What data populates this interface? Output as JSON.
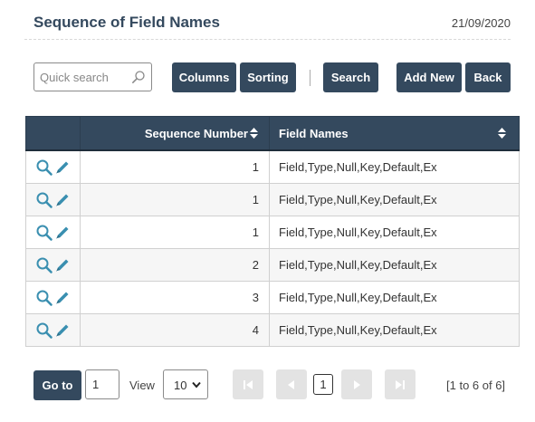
{
  "header": {
    "title": "Sequence of Field Names",
    "date": "21/09/2020"
  },
  "toolbar": {
    "search_placeholder": "Quick search",
    "columns_label": "Columns",
    "sorting_label": "Sorting",
    "search_label": "Search",
    "add_new_label": "Add New",
    "back_label": "Back"
  },
  "table": {
    "columns": [
      "Sequence Number",
      "Field Names"
    ],
    "rows": [
      {
        "sequence": "1",
        "field_names": "Field,Type,Null,Key,Default,Ex"
      },
      {
        "sequence": "1",
        "field_names": "Field,Type,Null,Key,Default,Ex"
      },
      {
        "sequence": "1",
        "field_names": "Field,Type,Null,Key,Default,Ex"
      },
      {
        "sequence": "2",
        "field_names": "Field,Type,Null,Key,Default,Ex"
      },
      {
        "sequence": "3",
        "field_names": "Field,Type,Null,Key,Default,Ex"
      },
      {
        "sequence": "4",
        "field_names": "Field,Type,Null,Key,Default,Ex"
      }
    ]
  },
  "pagination": {
    "goto_label": "Go to",
    "page_input": "1",
    "view_label": "View",
    "page_size": "10",
    "current_page": "1",
    "range": "[1 to 6 of 6]"
  },
  "icons": {
    "search": "magnifier-icon",
    "view_row": "magnifier-icon",
    "edit_row": "pencil-icon",
    "sort": "sort-updown-icon",
    "first": "first-page-icon",
    "prev": "prev-page-icon",
    "next": "next-page-icon",
    "last": "last-page-icon"
  },
  "colors": {
    "primary": "#34495e",
    "icon_teal": "#3a8fb0",
    "disabled": "#e3e3e3"
  }
}
